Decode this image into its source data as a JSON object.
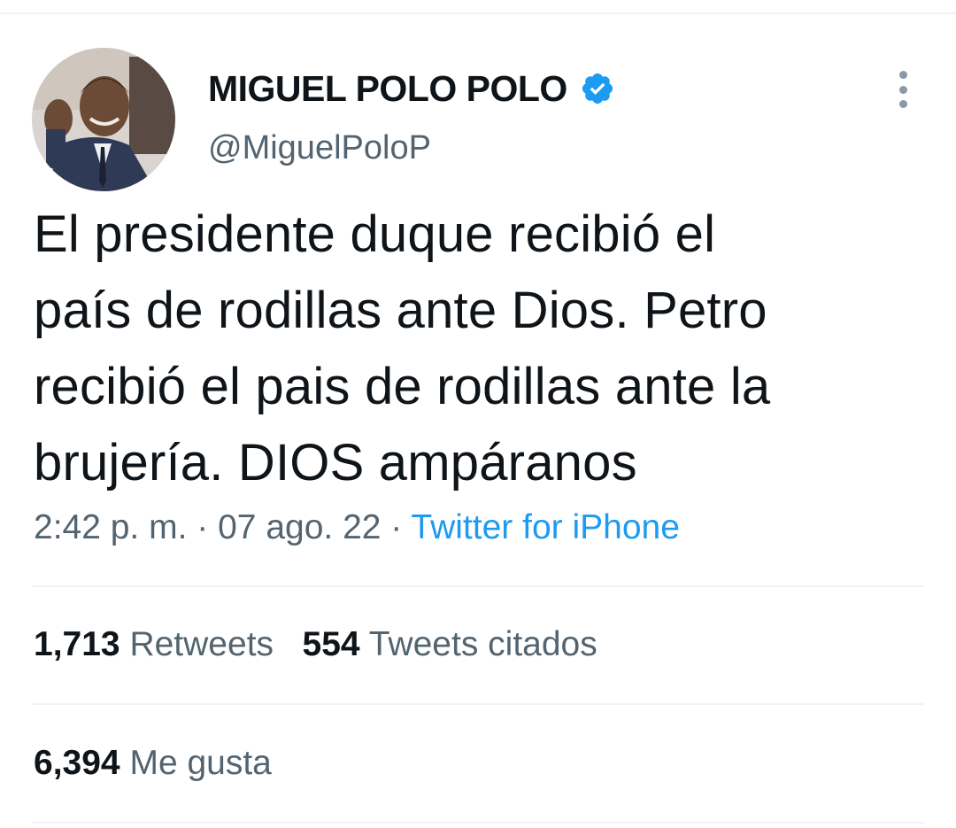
{
  "author": {
    "display_name": "MIGUEL POLO POLO",
    "handle": "@MiguelPoloP",
    "verified": true
  },
  "tweet": {
    "lines": [
      "El presidente duque recibió el",
      "país de rodillas ante Dios. Petro",
      "recibió el pais de rodillas ante la",
      "brujería. DIOS ampáranos"
    ]
  },
  "meta": {
    "time": "2:42 p. m.",
    "separator1": " · ",
    "date": "07 ago. 22",
    "separator2": " · ",
    "source": "Twitter for iPhone"
  },
  "stats": {
    "retweets_count": "1,713",
    "retweets_label": "Retweets",
    "quotes_count": "554",
    "quotes_label": "Tweets citados",
    "likes_count": "6,394",
    "likes_label": "Me gusta"
  },
  "colors": {
    "text_primary": "#0f1419",
    "text_secondary": "#536471",
    "link": "#1d9bf0",
    "verified": "#1d9bf0",
    "divider": "#eff3f4"
  },
  "icons": {
    "verified": "verified-badge-icon",
    "more": "more-vertical-icon"
  }
}
